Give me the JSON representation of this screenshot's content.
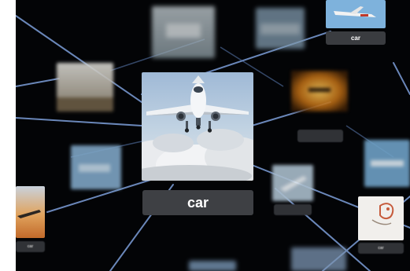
{
  "main_card": {
    "label": "car",
    "image": "airplane-above-clouds"
  },
  "top_right_card": {
    "label": "car",
    "image": "airplane-on-sky"
  },
  "bottom_right_card": {
    "label": "car",
    "image": "bird-sketch"
  },
  "left_small_card": {
    "label": "car",
    "image": "plane-at-sunset"
  },
  "colors": {
    "background": "#030406",
    "edge": "#7c9ed9",
    "caption_bg": "#3e4044"
  }
}
